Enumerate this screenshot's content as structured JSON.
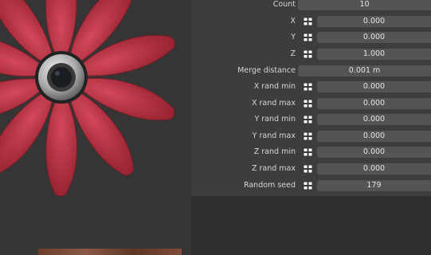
{
  "modifier_panel": {
    "rows": [
      {
        "id": "count",
        "label": "Count",
        "value": "10",
        "has_lock": false
      },
      {
        "id": "x",
        "label": "X",
        "value": "0.000",
        "has_lock": true
      },
      {
        "id": "y",
        "label": "Y",
        "value": "0.000",
        "has_lock": true
      },
      {
        "id": "z",
        "label": "Z",
        "value": "1.000",
        "has_lock": true
      },
      {
        "id": "merge_distance",
        "label": "Merge distance",
        "value": "0.001 m",
        "has_lock": false
      },
      {
        "id": "x_rand_min",
        "label": "X rand min",
        "value": "0.000",
        "has_lock": true
      },
      {
        "id": "x_rand_max",
        "label": "X rand max",
        "value": "0.000",
        "has_lock": true
      },
      {
        "id": "y_rand_min",
        "label": "Y rand min",
        "value": "0.000",
        "has_lock": true
      },
      {
        "id": "y_rand_max",
        "label": "Y rand max",
        "value": "0.000",
        "has_lock": true
      },
      {
        "id": "z_rand_min",
        "label": "Z rand min",
        "value": "0.000",
        "has_lock": true
      },
      {
        "id": "z_rand_max",
        "label": "Z rand max",
        "value": "0.000",
        "has_lock": true
      },
      {
        "id": "random_seed",
        "label": "Random seed",
        "value": "179",
        "has_lock": true
      }
    ]
  },
  "colors": {
    "petal": "#c0303f",
    "petal_dark": "#8f1f2c",
    "hub_metal": "#b8b8b8",
    "panel_bg": "#3d3d3d",
    "field_bg": "#545454"
  },
  "icons": {
    "lock": "lock-toggle-icon"
  }
}
